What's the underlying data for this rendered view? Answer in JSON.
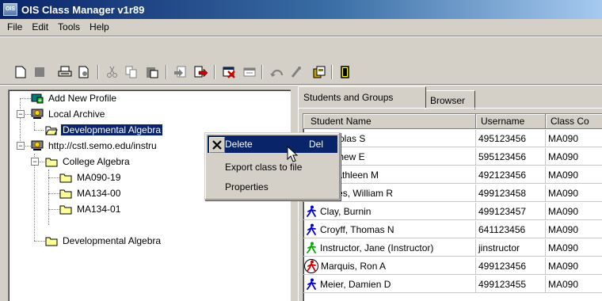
{
  "window": {
    "title": "OIS Class Manager v1r89",
    "icon_text": "OIS"
  },
  "menu": [
    "File",
    "Edit",
    "Tools",
    "Help"
  ],
  "toolbar": {
    "buttons": [
      "new-icon",
      "stop-icon",
      "print-icon",
      "print-preview-icon",
      "cut-icon",
      "copy-icon",
      "paste-icon",
      "import-icon",
      "export-icon",
      "delete-icon",
      "window-icon",
      "refresh-icon",
      "wand-icon",
      "files-icon",
      "exit-icon"
    ]
  },
  "tree": {
    "items": [
      {
        "label": "Add New Profile",
        "icon": "add-profile-icon"
      },
      {
        "label": "Local Archive",
        "icon": "archive-icon"
      },
      {
        "label": "Developmental Algebra",
        "icon": "folder-open-icon"
      },
      {
        "label": "http://cstl.semo.edu/instru",
        "icon": "server-icon"
      },
      {
        "label": "College Algebra",
        "icon": "folder-icon"
      },
      {
        "label": "MA090-19",
        "icon": "folder-icon"
      },
      {
        "label": "MA134-00",
        "icon": "folder-icon"
      },
      {
        "label": "MA134-01",
        "icon": "folder-icon"
      },
      {
        "label": "Developmental Algebra",
        "icon": "folder-icon"
      }
    ]
  },
  "tabs": [
    {
      "label": "Students and Groups",
      "active": true
    },
    {
      "label": "Browser",
      "active": false
    }
  ],
  "grid": {
    "columns": [
      "Student Name",
      "Username",
      "Class Co"
    ],
    "rows": [
      {
        "name": "Nicholas S",
        "username": "495123456",
        "class_code": "MA090",
        "icon": "student-icon",
        "color": "#0000cc"
      },
      {
        "name": "Matthew E",
        "username": "595123456",
        "class_code": "MA090",
        "icon": "student-icon",
        "color": "#0000cc"
      },
      {
        "name": "h, Kathleen M",
        "username": "492123456",
        "class_code": "MA090",
        "icon": "student-icon",
        "color": "#0000cc"
      },
      {
        "name": "Canes, William R",
        "username": "499123458",
        "class_code": "MA090",
        "icon": "student-icon",
        "color": "#0000cc"
      },
      {
        "name": "Clay, Burnin",
        "username": "499123457",
        "class_code": "MA090",
        "icon": "student-icon",
        "color": "#0000cc"
      },
      {
        "name": "Croyff, Thomas N",
        "username": "641123456",
        "class_code": "MA090",
        "icon": "student-icon",
        "color": "#0000cc"
      },
      {
        "name": "Instructor, Jane (Instructor)",
        "username": "jinstructor",
        "class_code": "MA090",
        "icon": "instructor-icon",
        "color": "#00aa00"
      },
      {
        "name": "Marquis, Ron A",
        "username": "499123456",
        "class_code": "MA090",
        "icon": "student-flagged-icon",
        "color": "#cc0000"
      },
      {
        "name": "Meier, Damien D",
        "username": "499123455",
        "class_code": "MA090",
        "icon": "student-icon",
        "color": "#0000cc"
      }
    ]
  },
  "context_menu": {
    "items": [
      {
        "label": "Delete",
        "shortcut": "Del",
        "highlighted": true
      },
      {
        "label": "Export class to file",
        "shortcut": "",
        "highlighted": false
      },
      {
        "label": "Properties",
        "shortcut": "",
        "highlighted": false
      }
    ]
  },
  "colors": {
    "selection": "#0a246a",
    "title_start": "#0a246a",
    "title_end": "#a6caf0",
    "face": "#d4d0c8"
  }
}
